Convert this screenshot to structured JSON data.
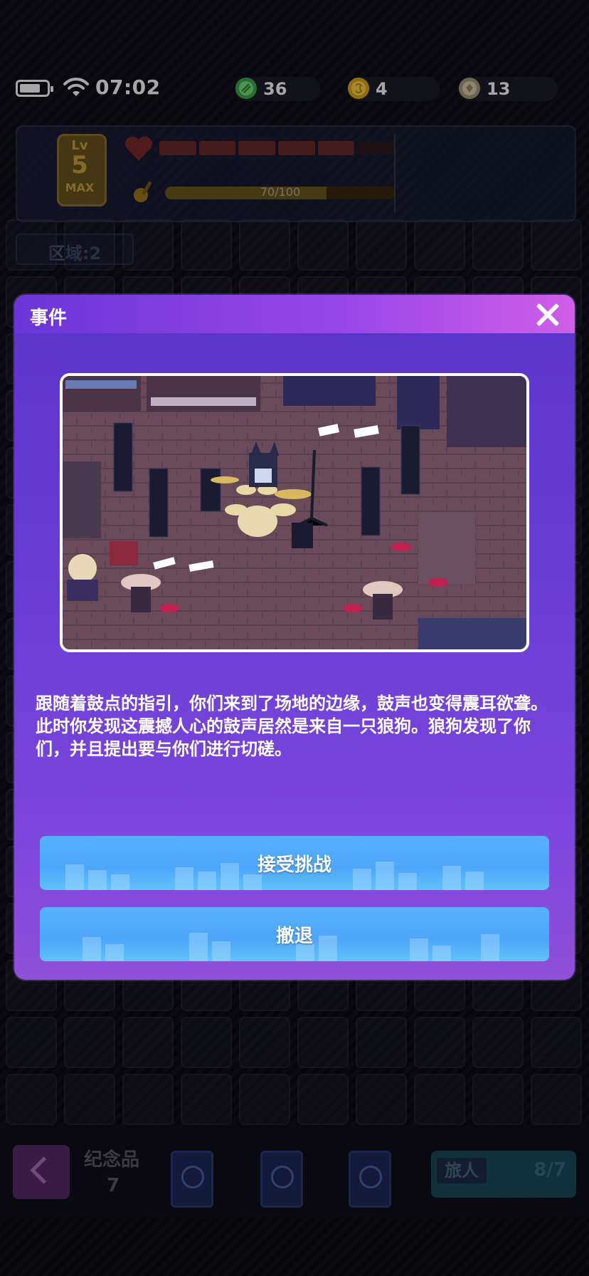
{
  "status_bar": {
    "time": "07:02",
    "battery_level": 0.7
  },
  "currencies": [
    {
      "name": "green-gem-icon",
      "value": "36",
      "color": "#4ec95a"
    },
    {
      "name": "gold-coin-icon",
      "value": "4",
      "color": "#f2c21e"
    },
    {
      "name": "silver-coin-icon",
      "value": "13",
      "color": "#c8b890"
    }
  ],
  "hud": {
    "level_prefix": "Lv",
    "level": "5",
    "level_max": "MAX",
    "hp_segments_filled": 5,
    "hp_segments_total": 6,
    "xp_text": "70/100",
    "xp_ratio": 0.7
  },
  "area": {
    "label": "区域:2"
  },
  "bottom_bar": {
    "souvenir_label": "纪念品",
    "souvenir_count": "7",
    "cards": [
      "compass-card-icon",
      "sword-card-icon",
      "lightning-card-icon"
    ],
    "traveler_label": "旅人",
    "traveler_ratio": "8/7"
  },
  "modal": {
    "title": "事件",
    "description": "跟随着鼓点的指引，你们来到了场地的边缘，鼓声也变得震耳欲聋。此时你发现这震撼人心的鼓声居然是来自一只狼狗。狼狗发现了你们，并且提出要与你们进行切磋。",
    "accept_label": "接受挑战",
    "retreat_label": "撤退"
  },
  "colors": {
    "modal_top": "#5a34c8",
    "header_accent": "#d05ee8",
    "button": "#4ca6fa"
  }
}
